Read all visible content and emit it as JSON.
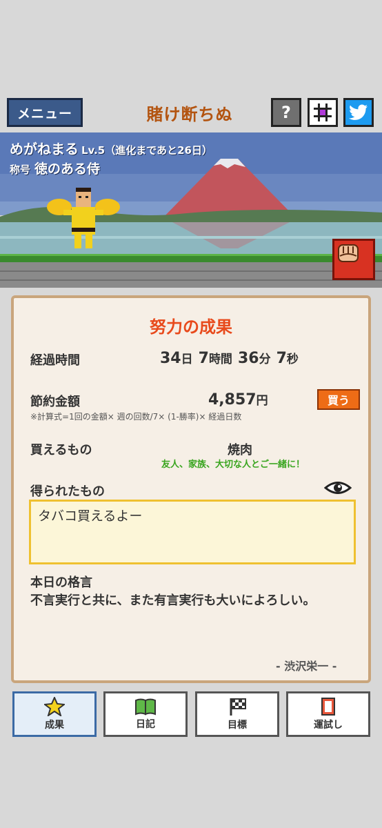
{
  "header": {
    "menu_label": "メニュー",
    "app_title": "賭け断ちぬ",
    "help_label": "?",
    "icons": [
      "grid-icon",
      "twitter-bird-icon"
    ]
  },
  "character": {
    "name": "めがねまる",
    "level": "Lv.5（進化まであと26日）",
    "title_prefix": "称号",
    "title": "徳のある侍"
  },
  "panel": {
    "heading": "努力の成果",
    "elapsed_label": "経過時間",
    "elapsed": {
      "days": "34",
      "days_unit": "日",
      "hours": "7",
      "hours_unit": "時間",
      "minutes": "36",
      "minutes_unit": "分",
      "seconds": "7",
      "seconds_unit": "秒"
    },
    "saved_label": "節約金額",
    "saved_amount": "4,857",
    "saved_unit": "円",
    "buy_label": "買う",
    "formula": "※計算式=1回の金額× 週の回数/7× (1-勝率)× 経過日数",
    "buyable_label": "買えるもの",
    "buyable_item": "焼肉",
    "buyable_note": "友人、家族、大切な人とご一緒に！",
    "gained_label": "得られたもの",
    "gained_text": "タバコ買えるよー",
    "quote_label": "本日の格言",
    "quote_text": "不言実行と共に、また有言実行も大いによろしい。",
    "quote_author": "- 渋沢栄一 -"
  },
  "tabs": [
    {
      "label": "成果",
      "icon": "star-icon",
      "active": true
    },
    {
      "label": "日記",
      "icon": "book-icon",
      "active": false
    },
    {
      "label": "目標",
      "icon": "flag-icon",
      "active": false
    },
    {
      "label": "運試し",
      "icon": "card-icon",
      "active": false
    }
  ],
  "colors": {
    "accent_orange": "#ee6c16",
    "heading_red": "#e84a1c",
    "menu_blue": "#3b5a8a",
    "twitter_blue": "#1d9bf0",
    "note_green": "#39a51f"
  }
}
